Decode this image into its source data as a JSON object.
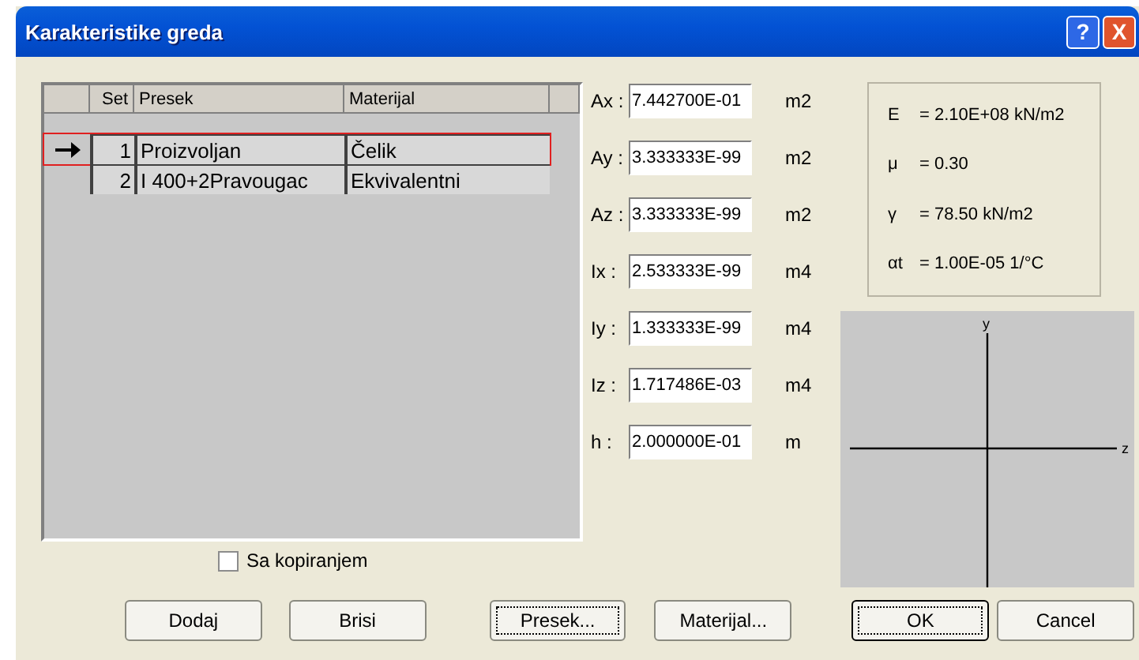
{
  "window": {
    "title": "Karakteristike greda"
  },
  "title_buttons": [
    {
      "kind": "help",
      "label": "?"
    },
    {
      "kind": "close",
      "label": "X"
    }
  ],
  "grid": {
    "columns": [
      "Set",
      "Presek",
      "Materijal"
    ],
    "rows": [
      {
        "set": "1",
        "presek": "Proizvoljan",
        "materijal": "Čelik",
        "selected": true
      },
      {
        "set": "2",
        "presek": "I 400+2Pravougac",
        "materijal": "Ekvivalentni",
        "selected": false
      }
    ]
  },
  "copy_checkbox": {
    "label": "Sa kopiranjem",
    "checked": false
  },
  "properties": [
    {
      "label": "Ax :",
      "value": "7.442700E-01",
      "unit": "m2"
    },
    {
      "label": "Ay :",
      "value": "3.333333E-99",
      "unit": "m2"
    },
    {
      "label": "Az :",
      "value": "3.333333E-99",
      "unit": "m2"
    },
    {
      "label": "Ix :",
      "value": "2.533333E-99",
      "unit": "m4"
    },
    {
      "label": "Iy :",
      "value": "1.333333E-99",
      "unit": "m4"
    },
    {
      "label": "Iz :",
      "value": "1.717486E-03",
      "unit": "m4"
    },
    {
      "label": "h :",
      "value": "2.000000E-01",
      "unit": "m"
    }
  ],
  "material": [
    {
      "symbol": "E",
      "value": "= 2.10E+08 kN/m2"
    },
    {
      "symbol": "μ",
      "value": "= 0.30"
    },
    {
      "symbol": "γ",
      "value": "= 78.50 kN/m2"
    },
    {
      "symbol": "αt",
      "value": "= 1.00E-05 1/°C"
    }
  ],
  "plot": {
    "y_label": "y",
    "z_label": "z"
  },
  "buttons": [
    {
      "label": "Dodaj",
      "focused": false,
      "default": false
    },
    {
      "label": "Brisi",
      "focused": false,
      "default": false
    },
    {
      "label": "Presek...",
      "focused": true,
      "default": false
    },
    {
      "label": "Materijal...",
      "focused": false,
      "default": false
    },
    {
      "label": "OK",
      "focused": true,
      "default": true
    },
    {
      "label": "Cancel",
      "focused": false,
      "default": false
    }
  ]
}
